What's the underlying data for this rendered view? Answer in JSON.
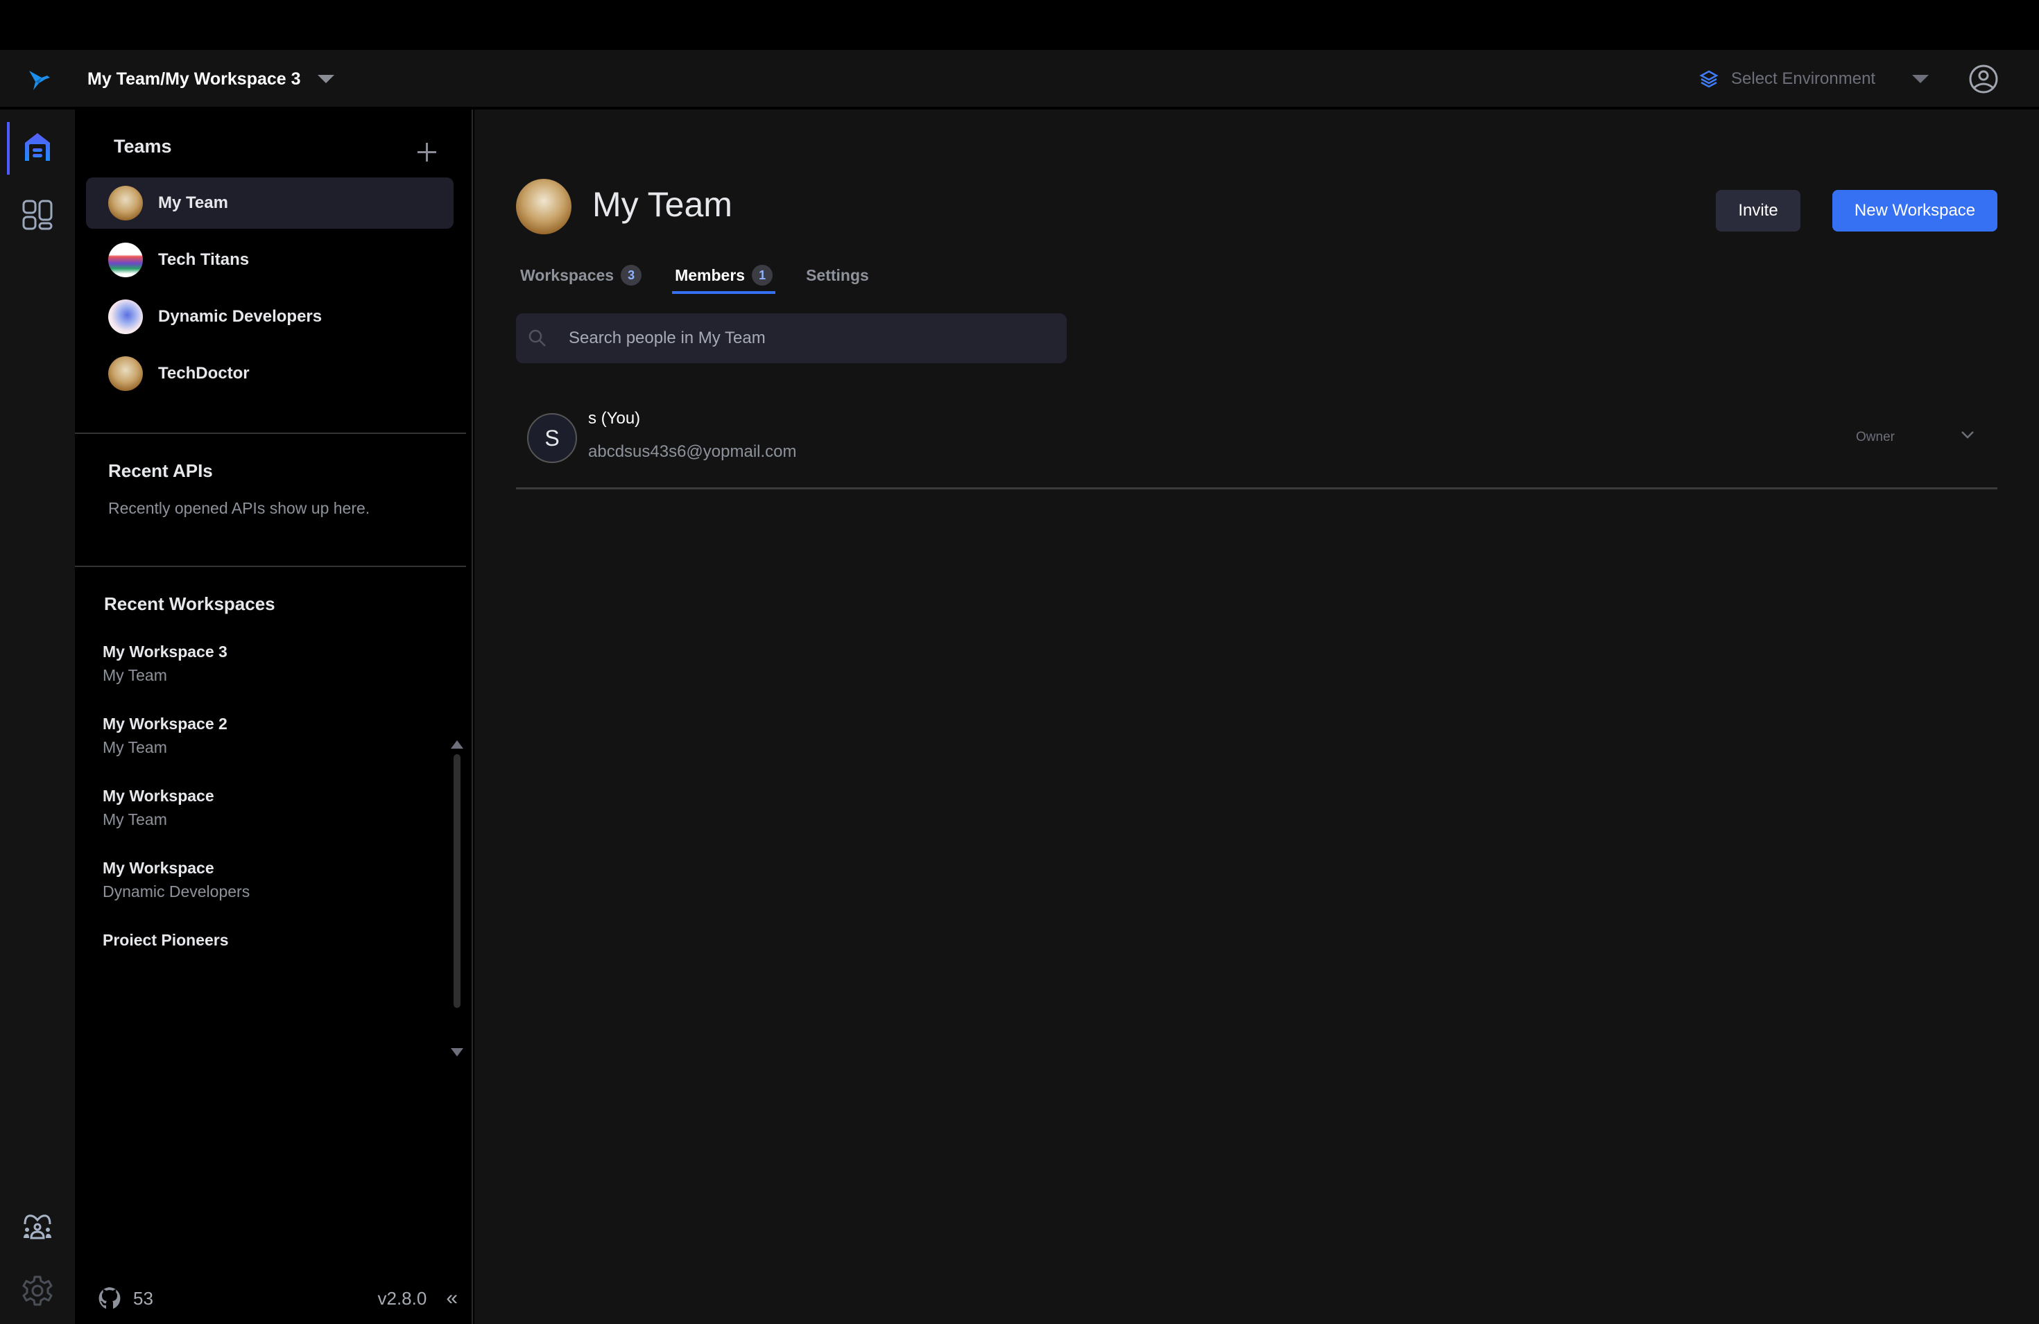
{
  "header": {
    "workspace_path": "My Team/My Workspace 3",
    "environment_placeholder": "Select Environment"
  },
  "rail": {
    "items": [
      {
        "name": "home",
        "icon": "home-icon",
        "active": true
      },
      {
        "name": "workspaces",
        "icon": "dashboard-icon",
        "active": false
      }
    ],
    "bottom_items": [
      {
        "name": "community",
        "icon": "team-icon"
      },
      {
        "name": "settings",
        "icon": "gear-icon"
      }
    ]
  },
  "sidebar": {
    "teams_title": "Teams",
    "teams": [
      {
        "name": "My Team",
        "active": true
      },
      {
        "name": "Tech Titans",
        "active": false
      },
      {
        "name": "Dynamic Developers",
        "active": false
      },
      {
        "name": "TechDoctor",
        "active": false
      }
    ],
    "recent_apis_title": "Recent APIs",
    "recent_apis_empty": "Recently opened APIs show up here.",
    "recent_workspaces_title": "Recent Workspaces",
    "recent_workspaces": [
      {
        "name": "My Workspace 3",
        "team": "My Team"
      },
      {
        "name": "My Workspace 2",
        "team": "My Team"
      },
      {
        "name": "My Workspace",
        "team": "My Team"
      },
      {
        "name": "My Workspace",
        "team": "Dynamic Developers"
      },
      {
        "name": "Proiect Pioneers",
        "team": ""
      }
    ],
    "footer": {
      "github_stars": "53",
      "version": "v2.8.0",
      "collapse_glyph": "«"
    }
  },
  "main": {
    "title": "My Team",
    "invite_label": "Invite",
    "new_workspace_label": "New Workspace",
    "tabs": [
      {
        "label": "Workspaces",
        "count": "3",
        "active": false
      },
      {
        "label": "Members",
        "count": "1",
        "active": true
      },
      {
        "label": "Settings",
        "count": null,
        "active": false
      }
    ],
    "search_placeholder": "Search people in My Team",
    "search_value": "",
    "members": [
      {
        "initial": "S",
        "name": "s (You)",
        "email": "abcdsus43s6@yopmail.com",
        "role": "Owner"
      }
    ]
  },
  "colors": {
    "accent": "#3671f4",
    "rail_active": "#4f5cff",
    "background": "#131313",
    "sidebar_bg": "#000000",
    "active_item_bg": "#1e1f2b"
  }
}
